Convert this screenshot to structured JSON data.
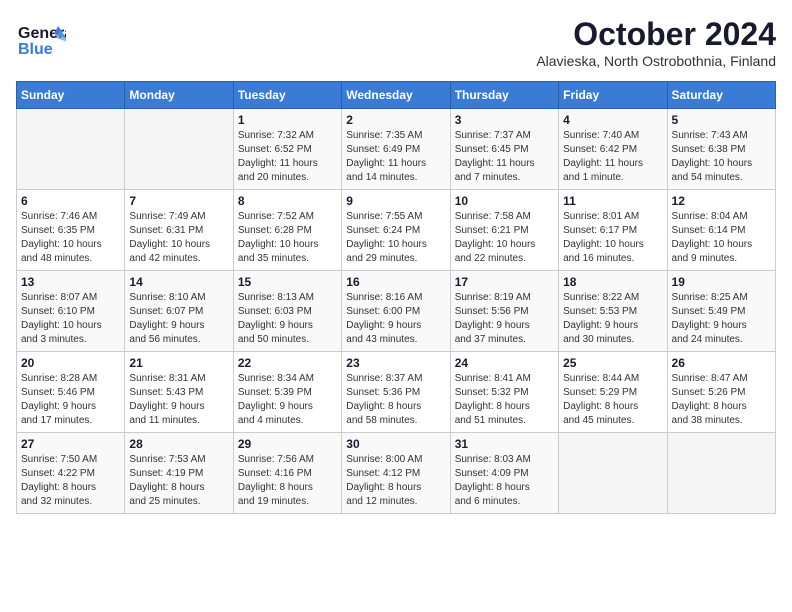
{
  "header": {
    "logo_general": "General",
    "logo_blue": "Blue",
    "title": "October 2024",
    "subtitle": "Alavieska, North Ostrobothnia, Finland"
  },
  "weekdays": [
    "Sunday",
    "Monday",
    "Tuesday",
    "Wednesday",
    "Thursday",
    "Friday",
    "Saturday"
  ],
  "weeks": [
    [
      {
        "day": "",
        "info": ""
      },
      {
        "day": "",
        "info": ""
      },
      {
        "day": "1",
        "info": "Sunrise: 7:32 AM\nSunset: 6:52 PM\nDaylight: 11 hours\nand 20 minutes."
      },
      {
        "day": "2",
        "info": "Sunrise: 7:35 AM\nSunset: 6:49 PM\nDaylight: 11 hours\nand 14 minutes."
      },
      {
        "day": "3",
        "info": "Sunrise: 7:37 AM\nSunset: 6:45 PM\nDaylight: 11 hours\nand 7 minutes."
      },
      {
        "day": "4",
        "info": "Sunrise: 7:40 AM\nSunset: 6:42 PM\nDaylight: 11 hours\nand 1 minute."
      },
      {
        "day": "5",
        "info": "Sunrise: 7:43 AM\nSunset: 6:38 PM\nDaylight: 10 hours\nand 54 minutes."
      }
    ],
    [
      {
        "day": "6",
        "info": "Sunrise: 7:46 AM\nSunset: 6:35 PM\nDaylight: 10 hours\nand 48 minutes."
      },
      {
        "day": "7",
        "info": "Sunrise: 7:49 AM\nSunset: 6:31 PM\nDaylight: 10 hours\nand 42 minutes."
      },
      {
        "day": "8",
        "info": "Sunrise: 7:52 AM\nSunset: 6:28 PM\nDaylight: 10 hours\nand 35 minutes."
      },
      {
        "day": "9",
        "info": "Sunrise: 7:55 AM\nSunset: 6:24 PM\nDaylight: 10 hours\nand 29 minutes."
      },
      {
        "day": "10",
        "info": "Sunrise: 7:58 AM\nSunset: 6:21 PM\nDaylight: 10 hours\nand 22 minutes."
      },
      {
        "day": "11",
        "info": "Sunrise: 8:01 AM\nSunset: 6:17 PM\nDaylight: 10 hours\nand 16 minutes."
      },
      {
        "day": "12",
        "info": "Sunrise: 8:04 AM\nSunset: 6:14 PM\nDaylight: 10 hours\nand 9 minutes."
      }
    ],
    [
      {
        "day": "13",
        "info": "Sunrise: 8:07 AM\nSunset: 6:10 PM\nDaylight: 10 hours\nand 3 minutes."
      },
      {
        "day": "14",
        "info": "Sunrise: 8:10 AM\nSunset: 6:07 PM\nDaylight: 9 hours\nand 56 minutes."
      },
      {
        "day": "15",
        "info": "Sunrise: 8:13 AM\nSunset: 6:03 PM\nDaylight: 9 hours\nand 50 minutes."
      },
      {
        "day": "16",
        "info": "Sunrise: 8:16 AM\nSunset: 6:00 PM\nDaylight: 9 hours\nand 43 minutes."
      },
      {
        "day": "17",
        "info": "Sunrise: 8:19 AM\nSunset: 5:56 PM\nDaylight: 9 hours\nand 37 minutes."
      },
      {
        "day": "18",
        "info": "Sunrise: 8:22 AM\nSunset: 5:53 PM\nDaylight: 9 hours\nand 30 minutes."
      },
      {
        "day": "19",
        "info": "Sunrise: 8:25 AM\nSunset: 5:49 PM\nDaylight: 9 hours\nand 24 minutes."
      }
    ],
    [
      {
        "day": "20",
        "info": "Sunrise: 8:28 AM\nSunset: 5:46 PM\nDaylight: 9 hours\nand 17 minutes."
      },
      {
        "day": "21",
        "info": "Sunrise: 8:31 AM\nSunset: 5:43 PM\nDaylight: 9 hours\nand 11 minutes."
      },
      {
        "day": "22",
        "info": "Sunrise: 8:34 AM\nSunset: 5:39 PM\nDaylight: 9 hours\nand 4 minutes."
      },
      {
        "day": "23",
        "info": "Sunrise: 8:37 AM\nSunset: 5:36 PM\nDaylight: 8 hours\nand 58 minutes."
      },
      {
        "day": "24",
        "info": "Sunrise: 8:41 AM\nSunset: 5:32 PM\nDaylight: 8 hours\nand 51 minutes."
      },
      {
        "day": "25",
        "info": "Sunrise: 8:44 AM\nSunset: 5:29 PM\nDaylight: 8 hours\nand 45 minutes."
      },
      {
        "day": "26",
        "info": "Sunrise: 8:47 AM\nSunset: 5:26 PM\nDaylight: 8 hours\nand 38 minutes."
      }
    ],
    [
      {
        "day": "27",
        "info": "Sunrise: 7:50 AM\nSunset: 4:22 PM\nDaylight: 8 hours\nand 32 minutes."
      },
      {
        "day": "28",
        "info": "Sunrise: 7:53 AM\nSunset: 4:19 PM\nDaylight: 8 hours\nand 25 minutes."
      },
      {
        "day": "29",
        "info": "Sunrise: 7:56 AM\nSunset: 4:16 PM\nDaylight: 8 hours\nand 19 minutes."
      },
      {
        "day": "30",
        "info": "Sunrise: 8:00 AM\nSunset: 4:12 PM\nDaylight: 8 hours\nand 12 minutes."
      },
      {
        "day": "31",
        "info": "Sunrise: 8:03 AM\nSunset: 4:09 PM\nDaylight: 8 hours\nand 6 minutes."
      },
      {
        "day": "",
        "info": ""
      },
      {
        "day": "",
        "info": ""
      }
    ]
  ]
}
